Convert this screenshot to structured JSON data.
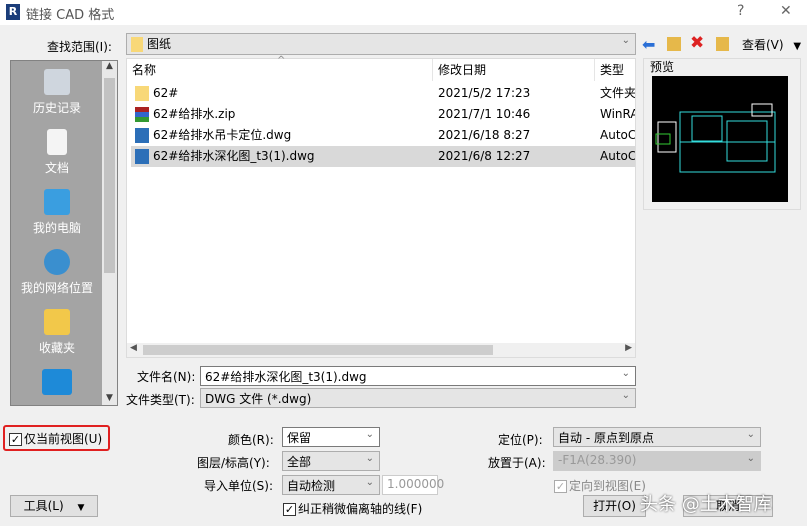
{
  "window": {
    "title": "链接 CAD 格式",
    "help": "?",
    "close": "✕"
  },
  "lookin": {
    "label": "查找范围(I):",
    "value": "图纸",
    "view_label": "查看(V)"
  },
  "sidebar": {
    "items": [
      {
        "label": "历史记录"
      },
      {
        "label": "文档"
      },
      {
        "label": "我的电脑"
      },
      {
        "label": "我的网络位置"
      },
      {
        "label": "收藏夹"
      }
    ]
  },
  "list": {
    "columns": [
      "名称",
      "修改日期",
      "类型"
    ],
    "rows": [
      {
        "name": "62#",
        "date": "2021/5/2 17:23",
        "type": "文件夹",
        "icon": "folder-icon"
      },
      {
        "name": "62#给排水.zip",
        "date": "2021/7/1 10:46",
        "type": "WinRAR",
        "icon": "zip-icon"
      },
      {
        "name": "62#给排水吊卡定位.dwg",
        "date": "2021/6/18 8:27",
        "type": "AutoCAD",
        "icon": "cad-icon"
      },
      {
        "name": "62#给排水深化图_t3(1).dwg",
        "date": "2021/6/8 12:27",
        "type": "AutoCAD",
        "icon": "cad-icon"
      }
    ]
  },
  "preview": {
    "label": "预览"
  },
  "filename": {
    "label": "文件名(N):",
    "value": "62#给排水深化图_t3(1).dwg"
  },
  "filetype": {
    "label": "文件类型(T):",
    "value": "DWG 文件 (*.dwg)"
  },
  "options": {
    "current_view": "仅当前视图(U)",
    "color_label": "颜色(R):",
    "color_value": "保留",
    "layer_label": "图层/标高(Y):",
    "layer_value": "全部",
    "units_label": "导入单位(S):",
    "units_value": "自动检测",
    "units_factor": "1.000000",
    "correct_lines": "纠正稍微偏离轴的线(F)",
    "position_label": "定位(P):",
    "position_value": "自动 - 原点到原点",
    "place_label": "放置于(A):",
    "place_value": "-F1A(28.390)",
    "orient": "定向到视图(E)"
  },
  "buttons": {
    "tools": "工具(L)",
    "open": "打开(O)",
    "cancel": "取消"
  },
  "watermark": "头条 @土木智库"
}
